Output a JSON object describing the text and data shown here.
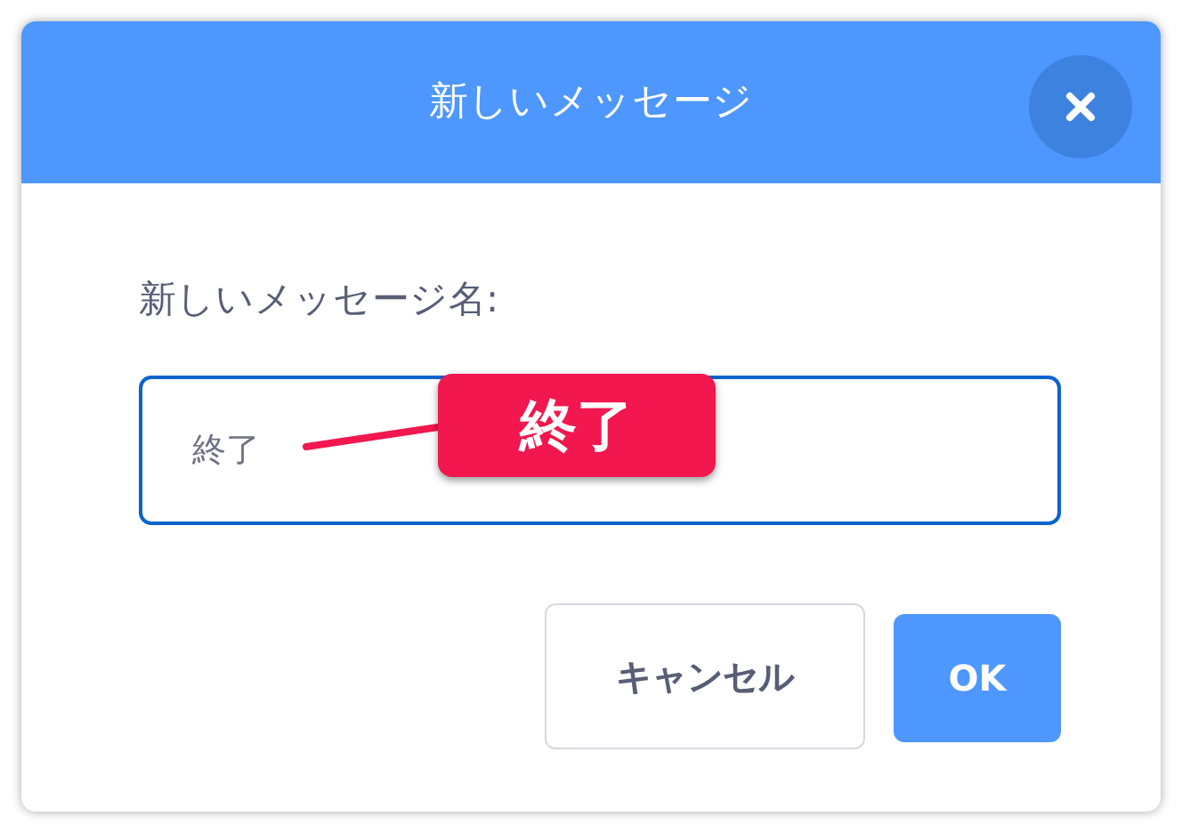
{
  "dialog": {
    "title": "新しいメッセージ"
  },
  "field": {
    "label": "新しいメッセージ名:",
    "value": "終了"
  },
  "callout": {
    "text": "終了"
  },
  "buttons": [
    {
      "label": "キャンセル",
      "kind": "secondary"
    },
    {
      "label": "OK",
      "kind": "primary"
    }
  ]
}
